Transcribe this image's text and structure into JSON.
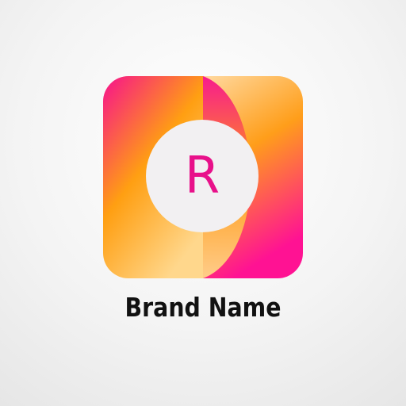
{
  "logo": {
    "monogram": "R",
    "colors": {
      "pink": "#f8078f",
      "magenta_text": "#e8118a",
      "orange": "#ff9a0c",
      "yellow": "#ffd280",
      "circle": "#f2f0f2"
    }
  },
  "brand": {
    "name": "Brand Name"
  }
}
